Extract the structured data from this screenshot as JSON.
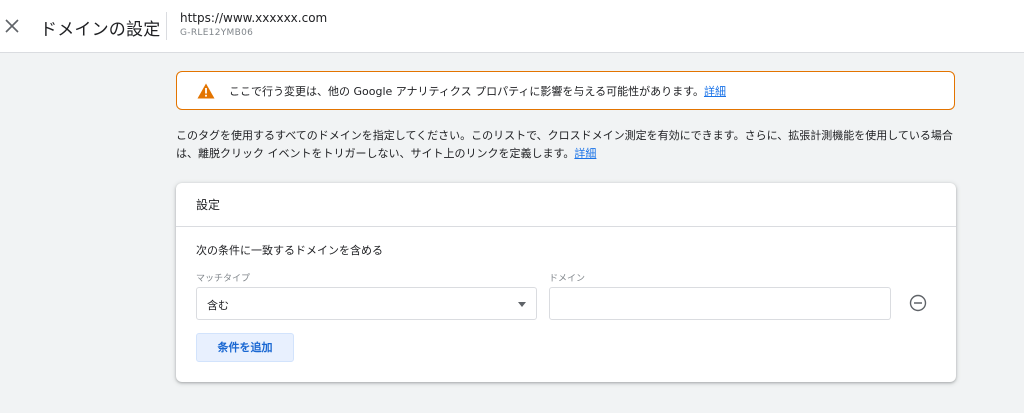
{
  "header": {
    "close_icon": "close-icon",
    "title": "ドメインの設定",
    "url": "https://www.xxxxxx.com",
    "measurement_id": "G-RLE12YMB06"
  },
  "warning": {
    "icon": "warning-icon",
    "icon_color": "#e37400",
    "text": "ここで行う変更は、他の Google アナリティクス プロパティに影響を与える可能性があります。",
    "link": "詳細"
  },
  "description": {
    "text": "このタグを使用するすべてのドメインを指定してください。このリストで、クロスドメイン測定を有効にできます。さらに、拡張計測機能を使用している場合は、離脱クリック イベントをトリガーしない、サイト上のリンクを定義します。",
    "link": "詳細"
  },
  "settings_card": {
    "title": "設定",
    "condition_label": "次の条件に一致するドメインを含める",
    "match_type_label": "マッチタイプ",
    "match_type_value": "含む",
    "domain_label": "ドメイン",
    "domain_value": "",
    "domain_placeholder": "",
    "remove_icon": "remove-circle-icon",
    "add_button": "条件を追加"
  },
  "colors": {
    "accent": "#1a73e8",
    "warning_border": "#e37400",
    "background": "#f1f3f4"
  }
}
